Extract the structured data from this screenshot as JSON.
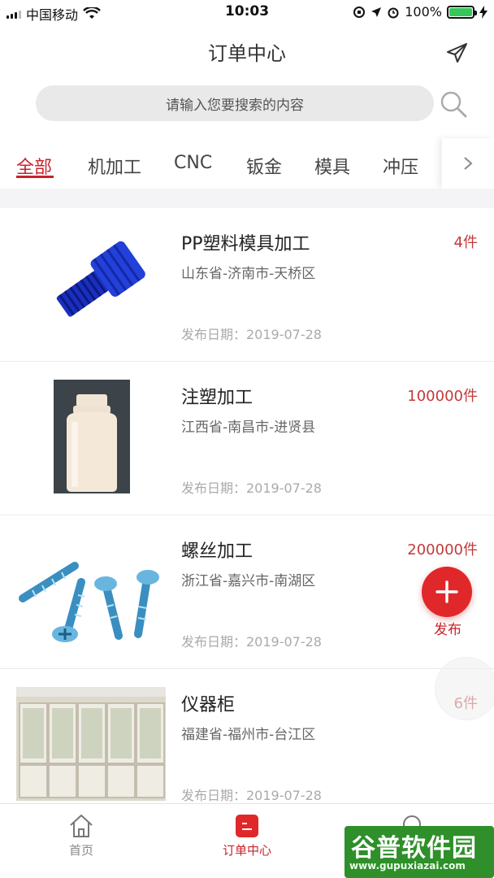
{
  "status_bar": {
    "carrier": "中国移动",
    "time": "10:03",
    "battery": "100%"
  },
  "header": {
    "title": "订单中心"
  },
  "search": {
    "placeholder": "请输入您要搜索的内容"
  },
  "tabs": {
    "items": [
      "全部",
      "机加工",
      "CNC",
      "钣金",
      "模具",
      "冲压"
    ],
    "active_index": 0
  },
  "orders": [
    {
      "name": "PP塑料模具加工",
      "quantity": "4件",
      "region": "山东省-济南市-天桥区",
      "date": "发布日期：2019-07-28",
      "image": "blue-plastic-fitting"
    },
    {
      "name": "注塑加工",
      "quantity": "100000件",
      "region": "江西省-南昌市-进贤县",
      "date": "发布日期：2019-07-28",
      "image": "white-plastic-bottle"
    },
    {
      "name": "螺丝加工",
      "quantity": "200000件",
      "region": "浙江省-嘉兴市-南湖区",
      "date": "发布日期：2019-07-28",
      "image": "screws"
    },
    {
      "name": "仪器柜",
      "quantity": "6件",
      "region": "福建省-福州市-台江区",
      "date": "发布日期：2019-07-28",
      "image": "instrument-cabinet"
    }
  ],
  "fab": {
    "label": "发布"
  },
  "bottom_nav": {
    "items": [
      {
        "label": "首页",
        "icon": "home-icon"
      },
      {
        "label": "订单中心",
        "icon": "order-center-icon"
      }
    ],
    "active_index": 1
  },
  "watermark": {
    "title": "谷普软件园",
    "url": "www.gupuxiazai.com"
  },
  "colors": {
    "accent": "#c8232b",
    "fab": "#e0282a",
    "search_bg": "#e9e9e9"
  }
}
